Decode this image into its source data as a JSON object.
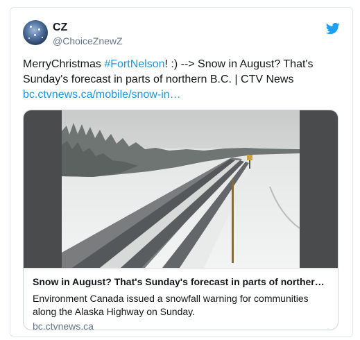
{
  "user": {
    "name": "CZ",
    "handle": "@ChoiceZnewZ"
  },
  "tweet": {
    "text_before": "MerryChristmas ",
    "hashtag": "#FortNelson",
    "text_after": "! :) --> Snow in August? That's Sunday's forecast in parts of northern B.C. | CTV News",
    "link": "bc.ctvnews.ca/mobile/snow-in…"
  },
  "card": {
    "title": "Snow in August? That's Sunday's forecast in parts of norther…",
    "description": "Environment Canada issued a snowfall warning for communities along the Alaska Highway on Sunday.",
    "domain": "bc.ctvnews.ca"
  },
  "icons": {
    "bird": "twitter-bird-icon"
  },
  "colors": {
    "accent": "#1b95e0",
    "text": "#14171a",
    "muted": "#657786",
    "border": "#e1e8ed"
  }
}
